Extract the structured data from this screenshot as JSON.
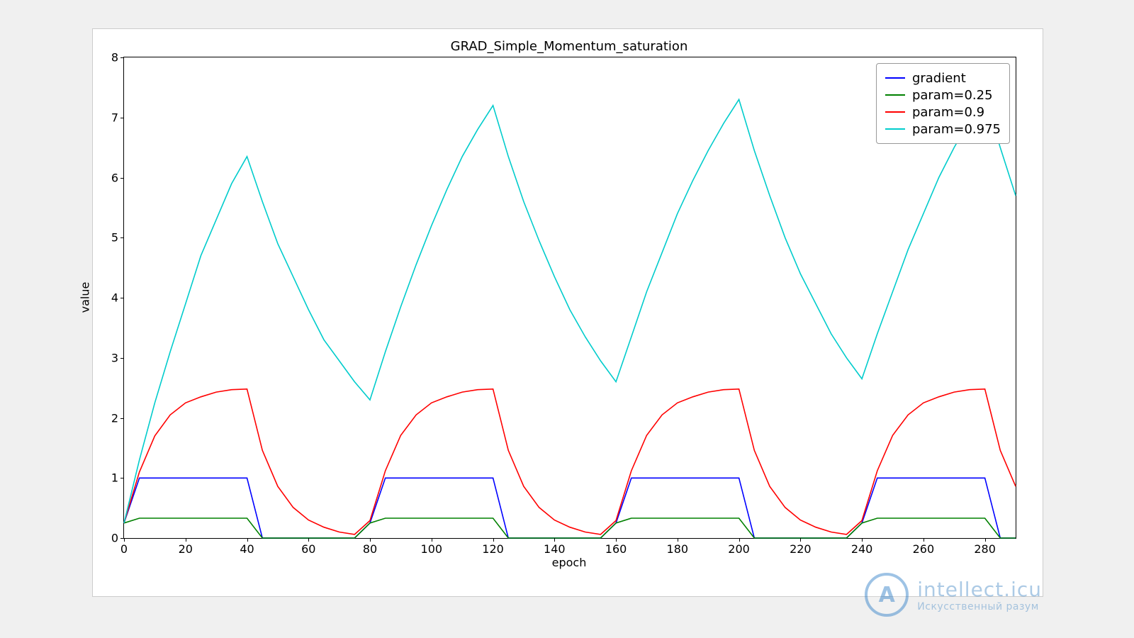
{
  "chart_data": {
    "type": "line",
    "title": "GRAD_Simple_Momentum_saturation",
    "xlabel": "epoch",
    "ylabel": "value",
    "xlim": [
      0,
      290
    ],
    "ylim": [
      0,
      8
    ],
    "x": [
      0,
      5,
      10,
      15,
      20,
      25,
      30,
      35,
      40,
      45,
      50,
      55,
      60,
      65,
      70,
      75,
      80,
      85,
      90,
      95,
      100,
      105,
      110,
      115,
      120,
      125,
      130,
      135,
      140,
      145,
      150,
      155,
      160,
      165,
      170,
      175,
      180,
      185,
      190,
      195,
      200,
      205,
      210,
      215,
      220,
      225,
      230,
      235,
      240,
      245,
      250,
      255,
      260,
      265,
      270,
      275,
      280,
      285,
      290
    ],
    "series": [
      {
        "name": "gradient",
        "color": "#0000ff",
        "values": [
          0.25,
          1.0,
          1.0,
          1.0,
          1.0,
          1.0,
          1.0,
          1.0,
          1.0,
          0.0,
          0.0,
          0.0,
          0.0,
          0.0,
          0.0,
          0.0,
          0.25,
          1.0,
          1.0,
          1.0,
          1.0,
          1.0,
          1.0,
          1.0,
          1.0,
          0.0,
          0.0,
          0.0,
          0.0,
          0.0,
          0.0,
          0.0,
          0.25,
          1.0,
          1.0,
          1.0,
          1.0,
          1.0,
          1.0,
          1.0,
          1.0,
          0.0,
          0.0,
          0.0,
          0.0,
          0.0,
          0.0,
          0.0,
          0.25,
          1.0,
          1.0,
          1.0,
          1.0,
          1.0,
          1.0,
          1.0,
          1.0,
          0.0,
          0.0
        ]
      },
      {
        "name": "param=0.25",
        "color": "#008000",
        "values": [
          0.25,
          0.33,
          0.33,
          0.33,
          0.33,
          0.33,
          0.33,
          0.33,
          0.33,
          0.0,
          0.0,
          0.0,
          0.0,
          0.0,
          0.0,
          0.0,
          0.25,
          0.33,
          0.33,
          0.33,
          0.33,
          0.33,
          0.33,
          0.33,
          0.33,
          0.0,
          0.0,
          0.0,
          0.0,
          0.0,
          0.0,
          0.0,
          0.25,
          0.33,
          0.33,
          0.33,
          0.33,
          0.33,
          0.33,
          0.33,
          0.33,
          0.0,
          0.0,
          0.0,
          0.0,
          0.0,
          0.0,
          0.0,
          0.25,
          0.33,
          0.33,
          0.33,
          0.33,
          0.33,
          0.33,
          0.33,
          0.33,
          0.0,
          0.0
        ]
      },
      {
        "name": "param=0.9",
        "color": "#ff0000",
        "values": [
          0.25,
          1.1,
          1.7,
          2.05,
          2.25,
          2.35,
          2.43,
          2.47,
          2.48,
          1.46,
          0.86,
          0.51,
          0.3,
          0.18,
          0.1,
          0.06,
          0.29,
          1.12,
          1.71,
          2.05,
          2.25,
          2.35,
          2.43,
          2.47,
          2.48,
          1.46,
          0.86,
          0.51,
          0.3,
          0.18,
          0.1,
          0.06,
          0.29,
          1.12,
          1.71,
          2.05,
          2.25,
          2.35,
          2.43,
          2.47,
          2.48,
          1.46,
          0.86,
          0.51,
          0.3,
          0.18,
          0.1,
          0.06,
          0.29,
          1.12,
          1.71,
          2.05,
          2.25,
          2.35,
          2.43,
          2.47,
          2.48,
          1.46,
          0.86
        ]
      },
      {
        "name": "param=0.975",
        "color": "#00cccc",
        "values": [
          0.25,
          1.3,
          2.25,
          3.1,
          3.9,
          4.7,
          5.3,
          5.9,
          6.35,
          5.6,
          4.9,
          4.35,
          3.8,
          3.3,
          2.95,
          2.6,
          2.3,
          3.1,
          3.85,
          4.55,
          5.2,
          5.8,
          6.35,
          6.8,
          7.2,
          6.35,
          5.6,
          4.95,
          4.35,
          3.8,
          3.35,
          2.95,
          2.6,
          3.35,
          4.1,
          4.75,
          5.4,
          5.95,
          6.45,
          6.9,
          7.3,
          6.45,
          5.7,
          5.0,
          4.4,
          3.9,
          3.4,
          3.0,
          2.65,
          3.4,
          4.1,
          4.8,
          5.4,
          6.0,
          6.5,
          6.95,
          7.35,
          6.5,
          5.7
        ]
      }
    ],
    "legend": [
      "gradient",
      "param=0.25",
      "param=0.9",
      "param=0.975"
    ],
    "yticks": [
      0,
      1,
      2,
      3,
      4,
      5,
      6,
      7,
      8
    ],
    "xticks": [
      0,
      20,
      40,
      60,
      80,
      100,
      120,
      140,
      160,
      180,
      200,
      220,
      240,
      260,
      280
    ]
  },
  "watermark": {
    "logo_text": "A",
    "main": "intellect.icu",
    "sub": "Искусственный разум"
  }
}
